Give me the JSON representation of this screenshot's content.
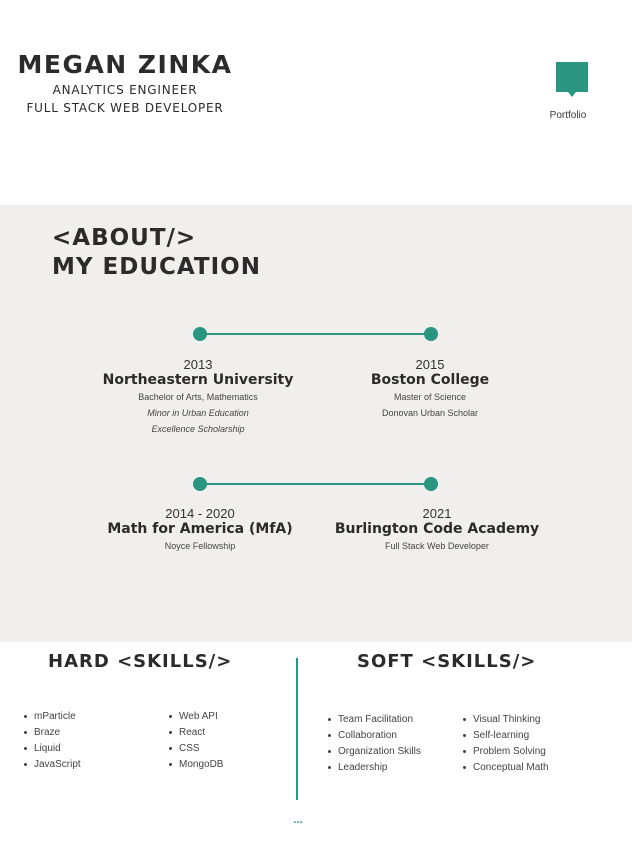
{
  "header": {
    "name": "MEGAN ZINKA",
    "title_1": "ANALYTICS ENGINEER",
    "title_2": "FULL STACK WEB DEVELOPER",
    "portfolio_label": "Portfolio",
    "portfolio_icon": "bookmark-icon"
  },
  "education": {
    "title_1": "<ABOUT/>",
    "title_2": "MY EDUCATION",
    "entries": [
      {
        "year": "2013",
        "school": "Northeastern University",
        "details": [
          "Bachelor of Arts, Mathematics",
          "Minor in Urban Education",
          "Excellence Scholarship"
        ]
      },
      {
        "year": "2015",
        "school": "Boston College",
        "details": [
          "Master of Science",
          "Donovan Urban Scholar"
        ]
      },
      {
        "year": "2014 - 2020",
        "school": "Math for America (MfA)",
        "details": [
          "Noyce Fellowship"
        ]
      },
      {
        "year": "2021",
        "school": "Burlington Code Academy",
        "details": [
          "Full Stack Web Developer"
        ]
      }
    ]
  },
  "skills": {
    "hard_title": "HARD <SKILLS/>",
    "soft_title": "SOFT <SKILLS/>",
    "hard_col_1": [
      "mParticle",
      "Braze",
      "Liquid",
      "JavaScript"
    ],
    "hard_col_2": [
      "Web API",
      "React",
      "CSS",
      "MongoDB"
    ],
    "soft_col_1": [
      "Team Facilitation",
      "Collaboration",
      "Organization Skills",
      "Leadership"
    ],
    "soft_col_2": [
      "Visual Thinking",
      "Self-learning",
      "Problem Solving",
      "Conceptual Math"
    ],
    "more": "..."
  },
  "colors": {
    "accent": "#2a9580",
    "band": "#f0efed",
    "text": "#2b2b2b"
  }
}
